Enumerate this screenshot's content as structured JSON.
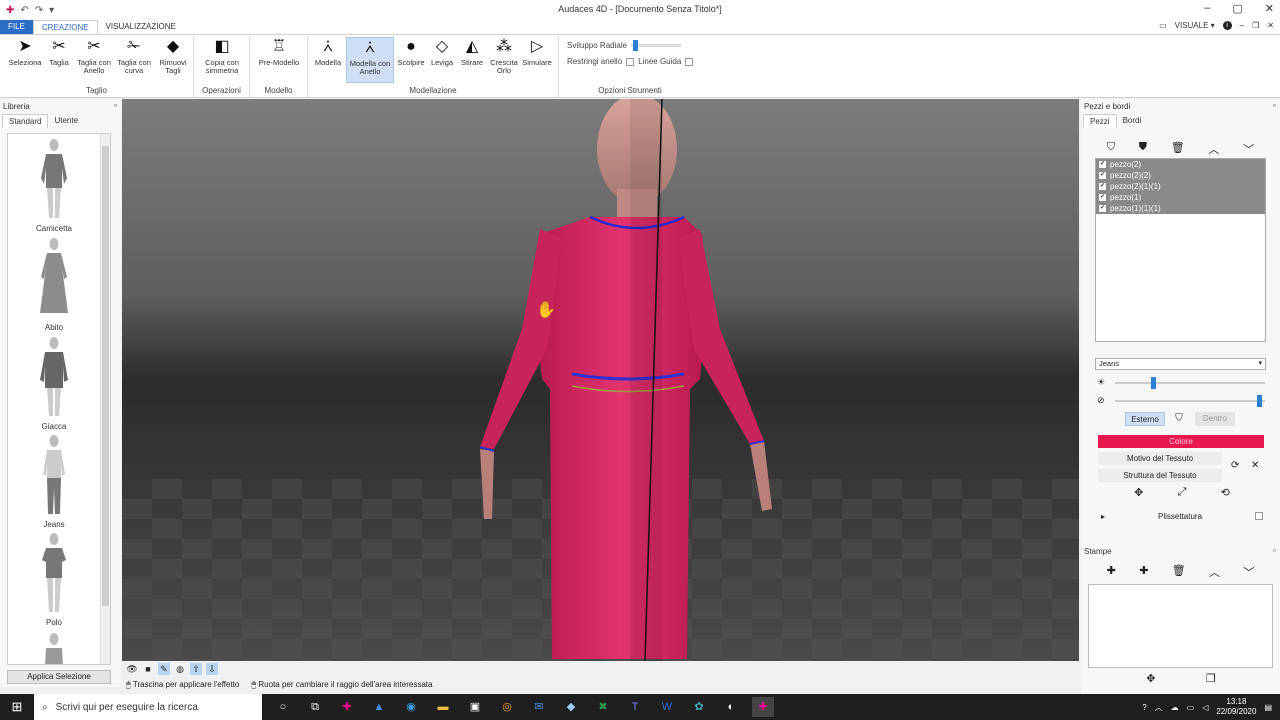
{
  "window": {
    "title": "Audaces 4D - [Documento Senza Titolo*]",
    "view_label": "VISUALE"
  },
  "menu": {
    "file": "FILE",
    "tabs": [
      "CREAZIONE",
      "VISUALIZZAZIONE"
    ]
  },
  "ribbon": {
    "taglio": {
      "name": "Taglio",
      "tools": [
        "Seleziona",
        "Taglia",
        "Taglia con Anello",
        "Taglia con curva",
        "Rimuovi Tagli"
      ]
    },
    "operazioni": {
      "name": "Operazioni",
      "tools": [
        "Copia con simmetria"
      ]
    },
    "modello": {
      "name": "Modello",
      "tools": [
        "Pre-Modello"
      ]
    },
    "modellazione": {
      "name": "Modellazione",
      "tools": [
        "Modella",
        "Modella con Anello",
        "Scolpire",
        "Leviga",
        "Stirare",
        "Crescita Orlo",
        "Simulare"
      ]
    },
    "opzioni": {
      "name": "Opzioni Strumenti",
      "sviluppo": "Sviluppo Radiale",
      "restringi": "Restringi anello",
      "linee": "Linee Guida",
      "sviluppo_value": 0.05
    }
  },
  "libreria": {
    "title": "Libreria",
    "tabs": [
      "Standard",
      "Utente"
    ],
    "items": [
      "Camicetta",
      "Abito",
      "Giacca",
      "Jeans",
      "Polo"
    ],
    "apply": "Applica Selezione"
  },
  "pieces": {
    "title": "Pezzi e bordi",
    "tabs": [
      "Pezzi",
      "Bordi"
    ],
    "list": [
      "pezzo(2)",
      "pezzo(2)(2)",
      "pezzo(2)(1)(1)",
      "pezzo(1)",
      "pezzo(1)(1)(1)"
    ],
    "fabric": "Jeans",
    "brightness": 0.25,
    "visibility": 0.98,
    "esterno": "Esterno",
    "dentro": "Dentro",
    "colore": "Colore",
    "colore_hex": "#e8174e",
    "motivo": "Motivo del Tessuto",
    "struttura": "Struttura del Tessuto",
    "plissettatura": "Plissettatura"
  },
  "stampe": {
    "title": "Stampe"
  },
  "status": {
    "hint1": "Trascina per applicare l'effetto",
    "hint2": "Ruota per cambiare il raggio dell'area interessata"
  },
  "taskbar": {
    "search": "Scrivi qui per eseguire la ricerca",
    "time": "13:18",
    "date": "22/09/2020"
  }
}
